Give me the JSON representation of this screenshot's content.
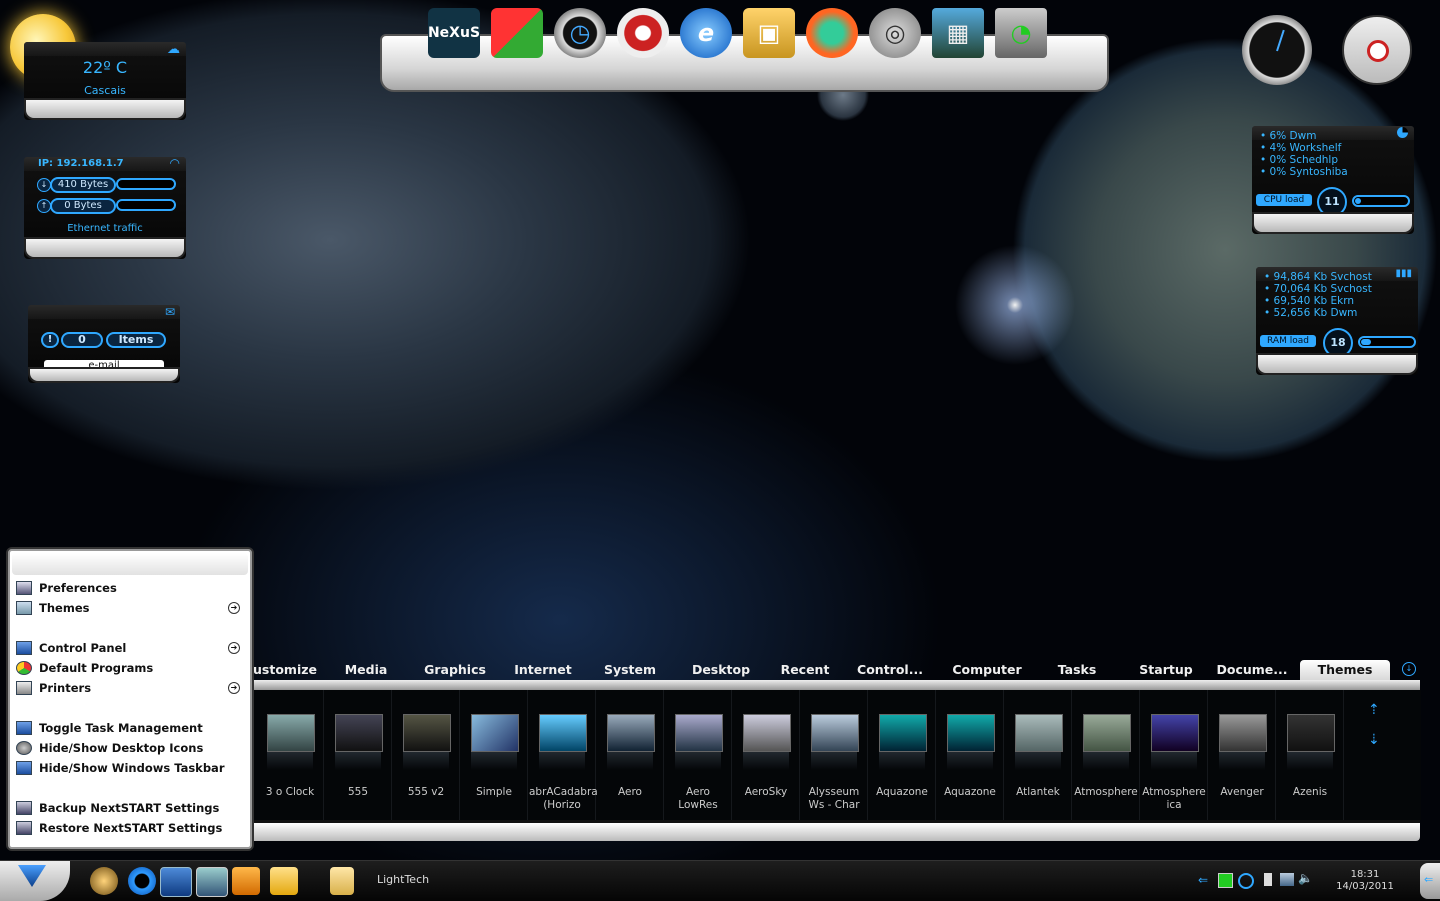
{
  "weather": {
    "temp": "22º C",
    "city": "Cascais"
  },
  "network": {
    "ip": "IP: 192.168.1.7",
    "down": "410 Bytes",
    "up": "0 Bytes",
    "label": "Ethernet traffic",
    "down_fraction": 0.0,
    "up_fraction": 0.0
  },
  "email": {
    "alert": "!",
    "count": "0",
    "items": "Items",
    "label": "e-mail"
  },
  "cpu": {
    "processes": [
      "• 6% Dwm",
      "• 4% Workshelf",
      "• 0% Schedhlp",
      "• 0% Syntoshiba"
    ],
    "label": "CPU load",
    "value": "11",
    "fraction": 0.11
  },
  "ram": {
    "processes": [
      "• 94,864 Kb Svchost",
      "• 70,064 Kb Svchost",
      "• 69,540 Kb Ekrn",
      "• 52,656 Kb Dwm"
    ],
    "label": "RAM load",
    "value": "18",
    "fraction": 0.18
  },
  "dock": {
    "icons": [
      {
        "name": "nexus-logo-icon",
        "glyph": "NeXuS"
      },
      {
        "name": "windows-logo-icon",
        "glyph": "⊞"
      },
      {
        "name": "clock-gadget-icon",
        "glyph": "◷"
      },
      {
        "name": "pokeball-icon",
        "glyph": "◉"
      },
      {
        "name": "internet-explorer-icon",
        "glyph": "e"
      },
      {
        "name": "picture-frame-icon",
        "glyph": "▣"
      },
      {
        "name": "firefox-icon",
        "glyph": "◐"
      },
      {
        "name": "disc-icon",
        "glyph": "◎"
      },
      {
        "name": "camera-icon",
        "glyph": "▦"
      },
      {
        "name": "desktop-clock-icon",
        "glyph": "◔"
      }
    ]
  },
  "start_menu": {
    "items": [
      {
        "label": "Preferences",
        "arrow": false
      },
      {
        "label": "Themes",
        "arrow": true
      },
      {
        "label": "Control Panel",
        "arrow": true
      },
      {
        "label": "Default Programs",
        "arrow": false
      },
      {
        "label": "Printers",
        "arrow": true
      },
      {
        "label": "Toggle Task Management",
        "arrow": false
      },
      {
        "label": "Hide/Show Desktop Icons",
        "arrow": false
      },
      {
        "label": "Hide/Show Windows Taskbar",
        "arrow": false
      },
      {
        "label": "Backup NextSTART Settings",
        "arrow": false
      },
      {
        "label": "Restore NextSTART Settings",
        "arrow": false
      }
    ],
    "arrow_glyph": "➔"
  },
  "tabs": [
    "ustomize",
    "Media",
    "Graphics",
    "Internet",
    "System",
    "Desktop",
    "Recent",
    "Control...",
    "Computer",
    "Tasks",
    "Startup",
    "Docume...",
    "Themes"
  ],
  "active_tab": "Themes",
  "themes": [
    {
      "label": "3 o Clock"
    },
    {
      "label": "555"
    },
    {
      "label": "555 v2"
    },
    {
      "label": "Simple"
    },
    {
      "label": "abrACadabra (Horizo"
    },
    {
      "label": "Aero"
    },
    {
      "label": "Aero LowRes"
    },
    {
      "label": "AeroSky"
    },
    {
      "label": "Alysseum Ws - Char"
    },
    {
      "label": "Aquazone"
    },
    {
      "label": "Aquazone"
    },
    {
      "label": "Atlantek"
    },
    {
      "label": "Atmosphere"
    },
    {
      "label": "Atmosphere ica"
    },
    {
      "label": "Avenger"
    },
    {
      "label": "Azenis"
    }
  ],
  "taskbar": {
    "active_window": "LightTech",
    "time": "18:31",
    "date": "14/03/2011"
  },
  "colors": {
    "accent": "#2fa8ff",
    "menu_bg": "#ffffff"
  }
}
